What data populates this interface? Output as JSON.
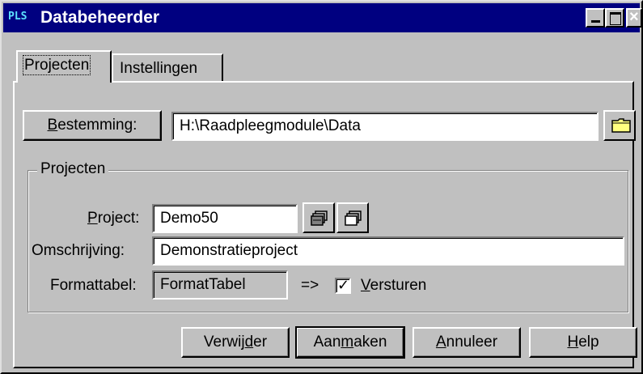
{
  "window": {
    "app_badge": "PLS",
    "title": "Databeheerder"
  },
  "tabs": [
    {
      "label": "Projecten",
      "active": true
    },
    {
      "label": "Instellingen",
      "active": false
    }
  ],
  "destination": {
    "button_prefix": "",
    "button_accel": "B",
    "button_rest": "estemming:",
    "value": "H:\\Raadpleegmodule\\Data"
  },
  "group": {
    "title": "Projecten",
    "project_label_accel": "P",
    "project_label_rest": "roject:",
    "project_value": "Demo50",
    "description_label": "Omschrijving:",
    "description_value": "Demonstratieproject",
    "format_label": "Formattabel:",
    "format_value": "FormatTabel",
    "arrow": "=>",
    "send_checked": true,
    "send_accel": "V",
    "send_rest": "ersturen"
  },
  "buttons": {
    "delete": {
      "pre": "Verwij",
      "accel": "d",
      "post": "er"
    },
    "create": {
      "pre": "Aan",
      "accel": "m",
      "post": "aken"
    },
    "cancel": {
      "pre": "",
      "accel": "A",
      "post": "nnuleer"
    },
    "help": {
      "pre": "",
      "accel": "H",
      "post": "elp"
    }
  },
  "colors": {
    "titlebar": "#000080",
    "face": "#c0c0c0",
    "folder": "#ffff80"
  },
  "icons": {
    "browse": "folder-icon",
    "project_open": "database-open-icon",
    "project_new": "database-new-icon"
  }
}
